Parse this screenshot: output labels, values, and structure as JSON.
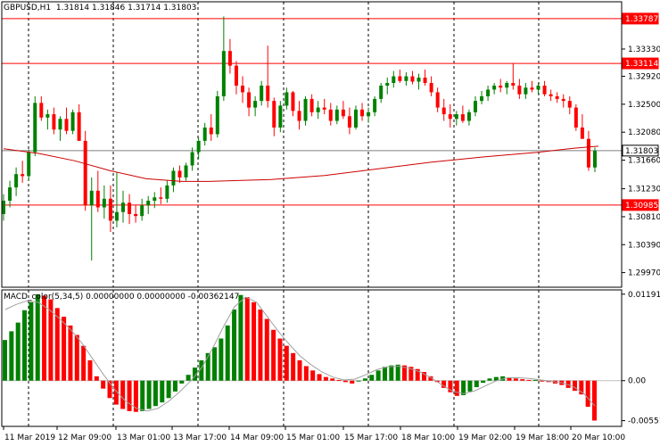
{
  "header": {
    "symbol": "GBPUSD,H1",
    "open": "1.31814",
    "high": "1.31846",
    "low": "1.31714",
    "close": "1.31803"
  },
  "price_axis": {
    "labels": [
      "1.33787",
      "1.33330",
      "1.33114",
      "1.32920",
      "1.32500",
      "1.32080",
      "1.31803",
      "1.31660",
      "1.31230",
      "1.30985",
      "1.30810",
      "1.30390",
      "1.29970"
    ],
    "ticks": [
      1.3333,
      1.3292,
      1.325,
      1.3208,
      1.3166,
      1.3123,
      1.3081,
      1.3039,
      1.2997
    ],
    "boxed": [
      {
        "label": "1.33787",
        "value": 1.33787,
        "kind": "level"
      },
      {
        "label": "1.33114",
        "value": 1.33114,
        "kind": "level"
      },
      {
        "label": "1.31803",
        "value": 1.31803,
        "kind": "current"
      },
      {
        "label": "1.30985",
        "value": 1.30985,
        "kind": "level"
      }
    ]
  },
  "macd_panel": {
    "title": "MACD_color(5,34,5) 0.00000000 0.00000000 -0.00362147",
    "labels": [
      "0.0119135",
      "0.00",
      "-0.005511"
    ],
    "values": [
      0.0119135,
      0.0,
      -0.005511
    ]
  },
  "time_axis": {
    "labels": [
      "11 Mar 2019",
      "12 Mar 09:00",
      "13 Mar 01:00",
      "13 Mar 17:00",
      "14 Mar 09:00",
      "15 Mar 01:00",
      "15 Mar 17:00",
      "18 Mar 10:00",
      "19 Mar 02:00",
      "19 Mar 18:00",
      "20 Mar 10:00"
    ]
  },
  "colors": {
    "bull": "#008000",
    "bear": "#ff0000",
    "ma_line": "#cc0000",
    "level_line": "#ff0000",
    "grid": "#000000",
    "signal_line": "#a0a0a0",
    "current_line": "#7f7f7f"
  },
  "chart_data": [
    {
      "type": "candlestick",
      "symbol": "GBPUSD",
      "timeframe": "H1",
      "y_range": [
        1.2975,
        1.3404
      ],
      "horizontal_levels": [
        1.33787,
        1.33114,
        1.30985
      ],
      "current_price": 1.31803,
      "moving_average": [
        {
          "x": 0,
          "y": 1.3183
        },
        {
          "x": 40,
          "y": 1.3176
        },
        {
          "x": 80,
          "y": 1.3165
        },
        {
          "x": 120,
          "y": 1.315
        },
        {
          "x": 160,
          "y": 1.3138
        },
        {
          "x": 200,
          "y": 1.3134
        },
        {
          "x": 230,
          "y": 1.3134
        },
        {
          "x": 300,
          "y": 1.3137
        },
        {
          "x": 360,
          "y": 1.3143
        },
        {
          "x": 420,
          "y": 1.3153
        },
        {
          "x": 480,
          "y": 1.3163
        },
        {
          "x": 540,
          "y": 1.3171
        },
        {
          "x": 600,
          "y": 1.3178
        },
        {
          "x": 640,
          "y": 1.3184
        },
        {
          "x": 667,
          "y": 1.3187
        }
      ],
      "candles": [
        [
          1.3085,
          1.3115,
          1.3075,
          1.3105
        ],
        [
          1.3105,
          1.3135,
          1.3095,
          1.3125
        ],
        [
          1.3125,
          1.3155,
          1.3112,
          1.3145
        ],
        [
          1.3145,
          1.3165,
          1.3132,
          1.3142
        ],
        [
          1.3142,
          1.3182,
          1.3135,
          1.3178
        ],
        [
          1.3178,
          1.3262,
          1.3172,
          1.3252
        ],
        [
          1.3252,
          1.3262,
          1.3225,
          1.323
        ],
        [
          1.323,
          1.3242,
          1.3212,
          1.3235
        ],
        [
          1.3235,
          1.3245,
          1.3205,
          1.3212
        ],
        [
          1.3212,
          1.3232,
          1.3195,
          1.3228
        ],
        [
          1.3228,
          1.3245,
          1.3205,
          1.321
        ],
        [
          1.321,
          1.3242,
          1.3205,
          1.3238
        ],
        [
          1.3238,
          1.325,
          1.3195,
          1.3195
        ],
        [
          1.3195,
          1.321,
          1.309,
          1.3098
        ],
        [
          1.3098,
          1.314,
          1.3015,
          1.312
        ],
        [
          1.312,
          1.315,
          1.3088,
          1.3095
        ],
        [
          1.3095,
          1.3128,
          1.3078,
          1.3108
        ],
        [
          1.3108,
          1.3128,
          1.3058,
          1.3075
        ],
        [
          1.3075,
          1.3148,
          1.3065,
          1.3088
        ],
        [
          1.3088,
          1.312,
          1.3072,
          1.3102
        ],
        [
          1.3102,
          1.3115,
          1.307,
          1.3085
        ],
        [
          1.3085,
          1.3098,
          1.3072,
          1.3082
        ],
        [
          1.3082,
          1.3108,
          1.3075,
          1.3098
        ],
        [
          1.3098,
          1.3112,
          1.3085,
          1.3105
        ],
        [
          1.3105,
          1.3118,
          1.3094,
          1.311
        ],
        [
          1.311,
          1.3125,
          1.31,
          1.3108
        ],
        [
          1.3108,
          1.3135,
          1.3102,
          1.3128
        ],
        [
          1.3128,
          1.3155,
          1.3118,
          1.315
        ],
        [
          1.315,
          1.3158,
          1.3132,
          1.314
        ],
        [
          1.314,
          1.3162,
          1.3135,
          1.3158
        ],
        [
          1.3158,
          1.3185,
          1.315,
          1.3178
        ],
        [
          1.3178,
          1.32,
          1.3168,
          1.3195
        ],
        [
          1.3195,
          1.3222,
          1.3188,
          1.3215
        ],
        [
          1.3215,
          1.3235,
          1.3195,
          1.3205
        ],
        [
          1.3205,
          1.327,
          1.32,
          1.3262
        ],
        [
          1.3262,
          1.3382,
          1.3255,
          1.333
        ],
        [
          1.333,
          1.3348,
          1.3296,
          1.3308
        ],
        [
          1.3308,
          1.3315,
          1.3265,
          1.3278
        ],
        [
          1.3278,
          1.3292,
          1.3252,
          1.3268
        ],
        [
          1.3268,
          1.3275,
          1.3232,
          1.3245
        ],
        [
          1.3245,
          1.3262,
          1.3232,
          1.3255
        ],
        [
          1.3255,
          1.3285,
          1.3248,
          1.3278
        ],
        [
          1.3278,
          1.3338,
          1.3245,
          1.3255
        ],
        [
          1.3255,
          1.326,
          1.3202,
          1.3215
        ],
        [
          1.3215,
          1.3255,
          1.3208,
          1.3248
        ],
        [
          1.3248,
          1.3275,
          1.3242,
          1.3268
        ],
        [
          1.3268,
          1.327,
          1.3232,
          1.324
        ],
        [
          1.324,
          1.3255,
          1.3212,
          1.3225
        ],
        [
          1.3225,
          1.3262,
          1.3218,
          1.3258
        ],
        [
          1.3258,
          1.3265,
          1.3232,
          1.3238
        ],
        [
          1.3238,
          1.3255,
          1.3228,
          1.3245
        ],
        [
          1.3245,
          1.3258,
          1.3235,
          1.3242
        ],
        [
          1.3242,
          1.3252,
          1.3218,
          1.3225
        ],
        [
          1.3225,
          1.3248,
          1.322,
          1.3242
        ],
        [
          1.3242,
          1.3255,
          1.3228,
          1.3232
        ],
        [
          1.3232,
          1.3245,
          1.3205,
          1.3215
        ],
        [
          1.3215,
          1.3248,
          1.3212,
          1.3242
        ],
        [
          1.3242,
          1.3252,
          1.3225,
          1.3232
        ],
        [
          1.3232,
          1.3245,
          1.3222,
          1.3238
        ],
        [
          1.3238,
          1.3262,
          1.3232,
          1.3258
        ],
        [
          1.3258,
          1.3282,
          1.3252,
          1.3278
        ],
        [
          1.3278,
          1.329,
          1.3265,
          1.3282
        ],
        [
          1.3282,
          1.33,
          1.3275,
          1.3292
        ],
        [
          1.3292,
          1.3302,
          1.3282,
          1.3285
        ],
        [
          1.3285,
          1.3298,
          1.3278,
          1.3292
        ],
        [
          1.3292,
          1.33,
          1.328,
          1.3284
        ],
        [
          1.3284,
          1.3296,
          1.3272,
          1.329
        ],
        [
          1.329,
          1.3302,
          1.3278,
          1.3282
        ],
        [
          1.3282,
          1.3292,
          1.3262,
          1.3268
        ],
        [
          1.3268,
          1.3275,
          1.3238,
          1.3245
        ],
        [
          1.3245,
          1.3258,
          1.3225,
          1.3235
        ],
        [
          1.3235,
          1.325,
          1.3215,
          1.3228
        ],
        [
          1.3228,
          1.324,
          1.3218,
          1.3235
        ],
        [
          1.3235,
          1.3248,
          1.3222,
          1.3225
        ],
        [
          1.3225,
          1.3242,
          1.3218,
          1.3238
        ],
        [
          1.3238,
          1.3262,
          1.3232,
          1.3255
        ],
        [
          1.3255,
          1.327,
          1.325,
          1.3262
        ],
        [
          1.3262,
          1.3278,
          1.3255,
          1.3272
        ],
        [
          1.3272,
          1.3282,
          1.3265,
          1.3278
        ],
        [
          1.3278,
          1.3288,
          1.3268,
          1.3275
        ],
        [
          1.3275,
          1.3285,
          1.3265,
          1.3282
        ],
        [
          1.3282,
          1.3312,
          1.3272,
          1.3278
        ],
        [
          1.3278,
          1.3288,
          1.3258,
          1.3265
        ],
        [
          1.3265,
          1.3282,
          1.3258,
          1.3275
        ],
        [
          1.3275,
          1.3285,
          1.3268,
          1.3272
        ],
        [
          1.3272,
          1.3282,
          1.3265,
          1.3278
        ],
        [
          1.3278,
          1.3285,
          1.3262,
          1.3265
        ],
        [
          1.3265,
          1.3272,
          1.3255,
          1.3262
        ],
        [
          1.3262,
          1.3268,
          1.3252,
          1.3258
        ],
        [
          1.3258,
          1.3265,
          1.3245,
          1.3255
        ],
        [
          1.3255,
          1.3262,
          1.3235,
          1.3245
        ],
        [
          1.3245,
          1.325,
          1.321,
          1.3215
        ],
        [
          1.3215,
          1.3235,
          1.3205,
          1.3198
        ],
        [
          1.3198,
          1.321,
          1.315,
          1.3155
        ],
        [
          1.3155,
          1.3185,
          1.3148,
          1.318
        ]
      ]
    },
    {
      "type": "bar",
      "indicator": "MACD_color(5,34,5)",
      "y_range": [
        -0.0063,
        0.0125
      ],
      "bar_colors": [
        "#008000",
        "#ff0000"
      ],
      "values": [
        0.0056,
        0.0068,
        0.008,
        0.0097,
        0.0108,
        0.0119,
        0.0117,
        0.0112,
        0.01,
        0.0088,
        0.0076,
        0.0063,
        0.0048,
        0.0028,
        0.0006,
        -0.0011,
        -0.0024,
        -0.0033,
        -0.0039,
        -0.0042,
        -0.0043,
        -0.0042,
        -0.0039,
        -0.0035,
        -0.003,
        -0.0024,
        -0.0015,
        -0.0004,
        0.0008,
        0.0018,
        0.0028,
        0.0038,
        0.0046,
        0.0058,
        0.0076,
        0.0098,
        0.0118,
        0.0115,
        0.0108,
        0.0098,
        0.0085,
        0.007,
        0.0058,
        0.0048,
        0.0038,
        0.0028,
        0.002,
        0.0014,
        0.0009,
        0.0005,
        0.0003,
        0.0001,
        -0.0002,
        -0.0004,
        -0.0001,
        0.0003,
        0.0008,
        0.0014,
        0.0019,
        0.0021,
        0.0022,
        0.0021,
        0.0019,
        0.0016,
        0.0012,
        0.0006,
        -0.0002,
        -0.001,
        -0.0016,
        -0.0021,
        -0.002,
        -0.0015,
        -0.0009,
        -0.0003,
        0.0003,
        0.0005,
        0.0006,
        0.0004,
        0.0003,
        0.0002,
        0.0001,
        0.0001,
        -0.0001,
        -0.0002,
        -0.0004,
        -0.0006,
        -0.001,
        -0.0014,
        -0.0019,
        -0.0036,
        -0.0055
      ],
      "signal": [
        0.0098,
        0.0105,
        0.011,
        0.0108,
        0.0098,
        0.0085,
        0.007,
        0.0052,
        0.003,
        0.0008,
        -0.0012,
        -0.0028,
        -0.0038,
        -0.0042,
        -0.0038,
        -0.0028,
        -0.0015,
        0.0,
        0.0018,
        0.0045,
        0.0075,
        0.0102,
        0.0115,
        0.0108,
        0.0088,
        0.0068,
        0.005,
        0.0034,
        0.0022,
        0.0012,
        0.0005,
        0.0001,
        0.0002,
        0.0008,
        0.0015,
        0.0019,
        0.002,
        0.0017,
        0.0012,
        0.0004,
        -0.0006,
        -0.0015,
        -0.0018,
        -0.0014,
        -0.0007,
        0.0,
        0.0004,
        0.0004,
        0.0003,
        0.0001,
        -0.0001,
        -0.0003,
        -0.0008,
        -0.0018,
        -0.0035
      ]
    }
  ]
}
